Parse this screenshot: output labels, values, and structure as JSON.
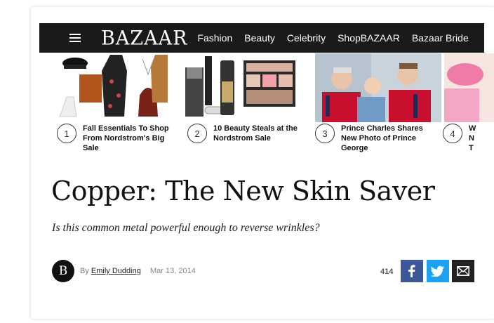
{
  "header": {
    "logo": "BAZAAR",
    "nav": [
      "Fashion",
      "Beauty",
      "Celebrity",
      "ShopBAZAAR",
      "Bazaar Bride"
    ]
  },
  "carousel": [
    {
      "num": "1",
      "text": "Fall Essentials To Shop From Nordstrom's Big Sale"
    },
    {
      "num": "2",
      "text": "10 Beauty Steals at the Nordstrom Sale"
    },
    {
      "num": "3",
      "text": "Prince Charles Shares New Photo of Prince George"
    },
    {
      "num": "4",
      "text": "W N T"
    }
  ],
  "article": {
    "title": "Copper: The New Skin Saver",
    "subtitle": "Is this common metal powerful enough to reverse wrinkles?",
    "avatar_letter": "B",
    "by_label": "By",
    "author": "Emily Dudding",
    "date": "Mar 13, 2014",
    "share_count": "414"
  },
  "colors": {
    "navbar": "#1a1a1a",
    "facebook": "#3b5998",
    "twitter": "#1da1f2",
    "email": "#222222"
  },
  "icons": [
    "menu-icon",
    "facebook-icon",
    "twitter-icon",
    "email-icon"
  ]
}
